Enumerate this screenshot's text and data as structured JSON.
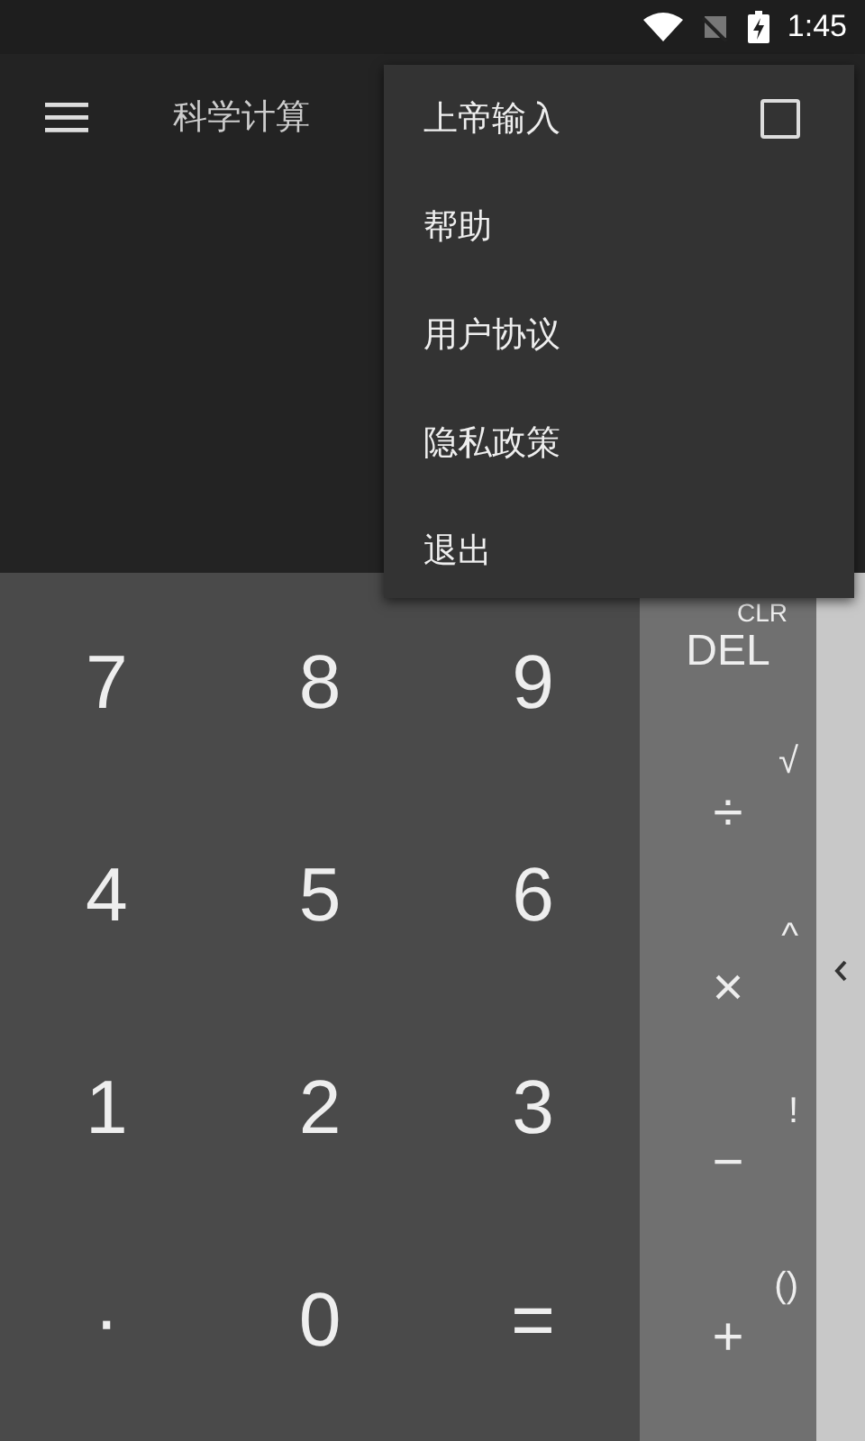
{
  "status_bar": {
    "time": "1:45"
  },
  "app_bar": {
    "title": "科学计算"
  },
  "menu": [
    {
      "label": "上帝输入",
      "kind": "checkbox",
      "checked": false
    },
    {
      "label": "帮助",
      "kind": "plain"
    },
    {
      "label": "用户协议",
      "kind": "plain"
    },
    {
      "label": "隐私政策",
      "kind": "plain"
    },
    {
      "label": "退出",
      "kind": "plain"
    }
  ],
  "digit_keys": [
    [
      "7",
      "8",
      "9"
    ],
    [
      "4",
      "5",
      "6"
    ],
    [
      "1",
      "2",
      "3"
    ],
    [
      "·",
      "0",
      "="
    ]
  ],
  "operator_keys": [
    {
      "main": "DEL",
      "secondary": "CLR"
    },
    {
      "main": "÷",
      "secondary": "√"
    },
    {
      "main": "×",
      "secondary": "^"
    },
    {
      "main": "−",
      "secondary": "!"
    },
    {
      "main": "+",
      "secondary": "()"
    }
  ]
}
